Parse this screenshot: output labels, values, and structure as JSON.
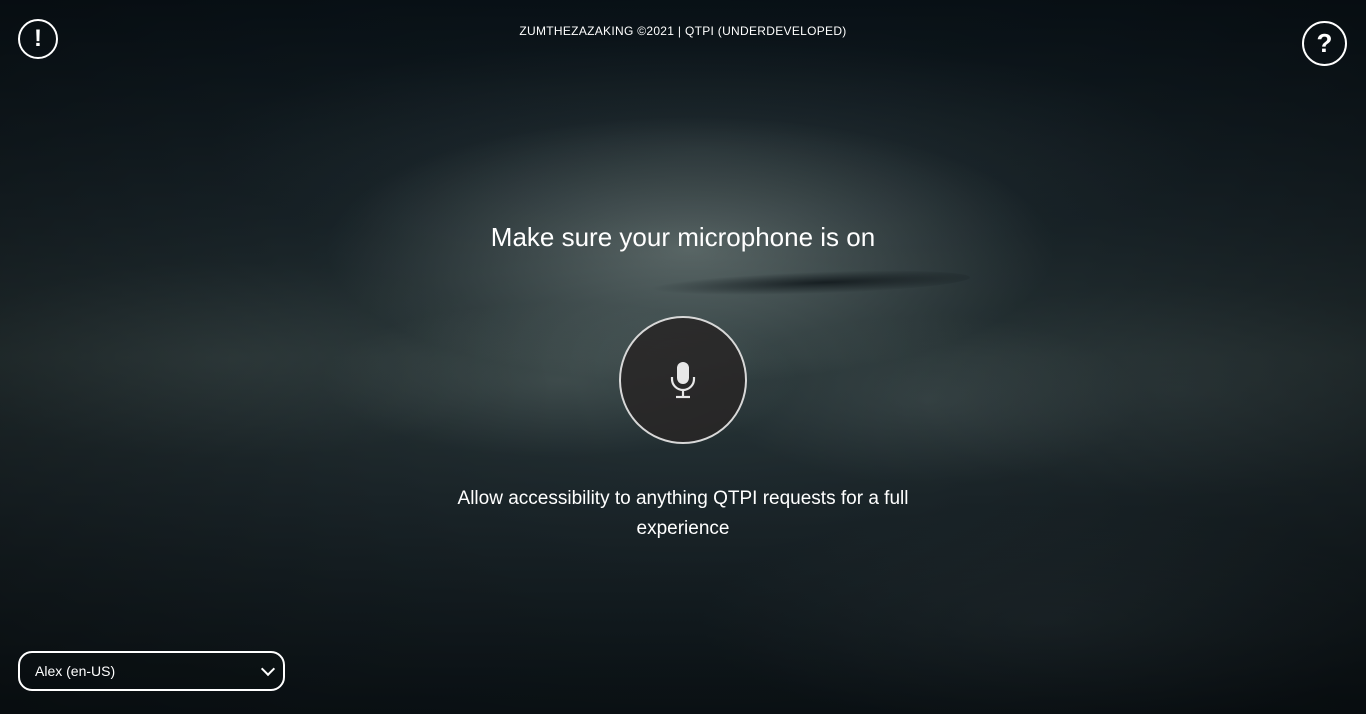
{
  "header": {
    "credits": "ZUMTHEZAZAKING ©2021 | QTPI (UNDERDEVELOPED)",
    "alert_icon": "exclamation-icon",
    "alert_glyph": "!",
    "help_icon": "question-icon",
    "help_glyph": "?"
  },
  "main": {
    "title": "Make sure your microphone is on",
    "mic_icon": "microphone-icon",
    "message": "Allow accessibility to anything QTPI requests for a full experience"
  },
  "voice_select": {
    "selected": "Alex (en-US)",
    "icon": "chevron-down-icon"
  },
  "colors": {
    "text": "#ffffff",
    "mic_bg": "#282626",
    "mic_border": "#d8d8d8"
  }
}
